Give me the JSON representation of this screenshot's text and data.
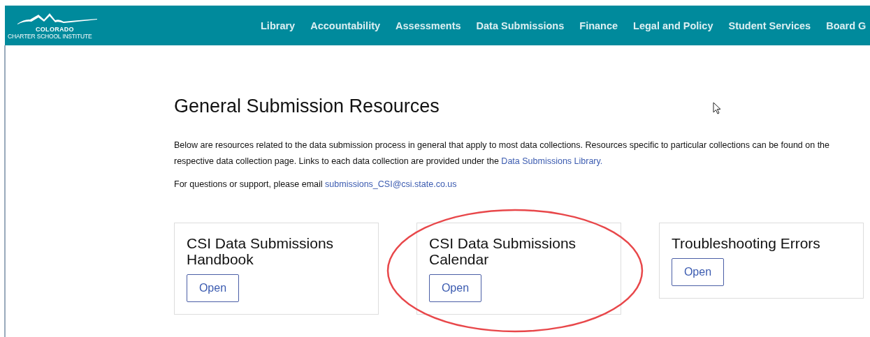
{
  "header": {
    "logo": {
      "line_1": "COLORADO",
      "line_2": "CHARTER SCHOOL INSTITUTE"
    },
    "nav": [
      "Library",
      "Accountability",
      "Assessments",
      "Data Submissions",
      "Finance",
      "Legal and Policy",
      "Student Services",
      "Board G"
    ]
  },
  "page": {
    "title": "General Submission Resources",
    "intro": {
      "text": "Below are resources related to the data submission process in general that apply to most data collections. Resources specific to particular collections can be found on the respective data collection page. Links to each data collection are provided under the ",
      "link": "Data Submissions Library."
    },
    "contact": {
      "text": "For questions or support, please email ",
      "link": "submissions_CSI@csi.state.co.us"
    },
    "cards": [
      {
        "title": "CSI Data Submissions Handbook",
        "button": "Open",
        "highlighted": false
      },
      {
        "title": "CSI Data Submissions Calendar",
        "button": "Open",
        "highlighted": true
      },
      {
        "title": "Troubleshooting Errors",
        "button": "Open",
        "highlighted": false
      }
    ]
  }
}
